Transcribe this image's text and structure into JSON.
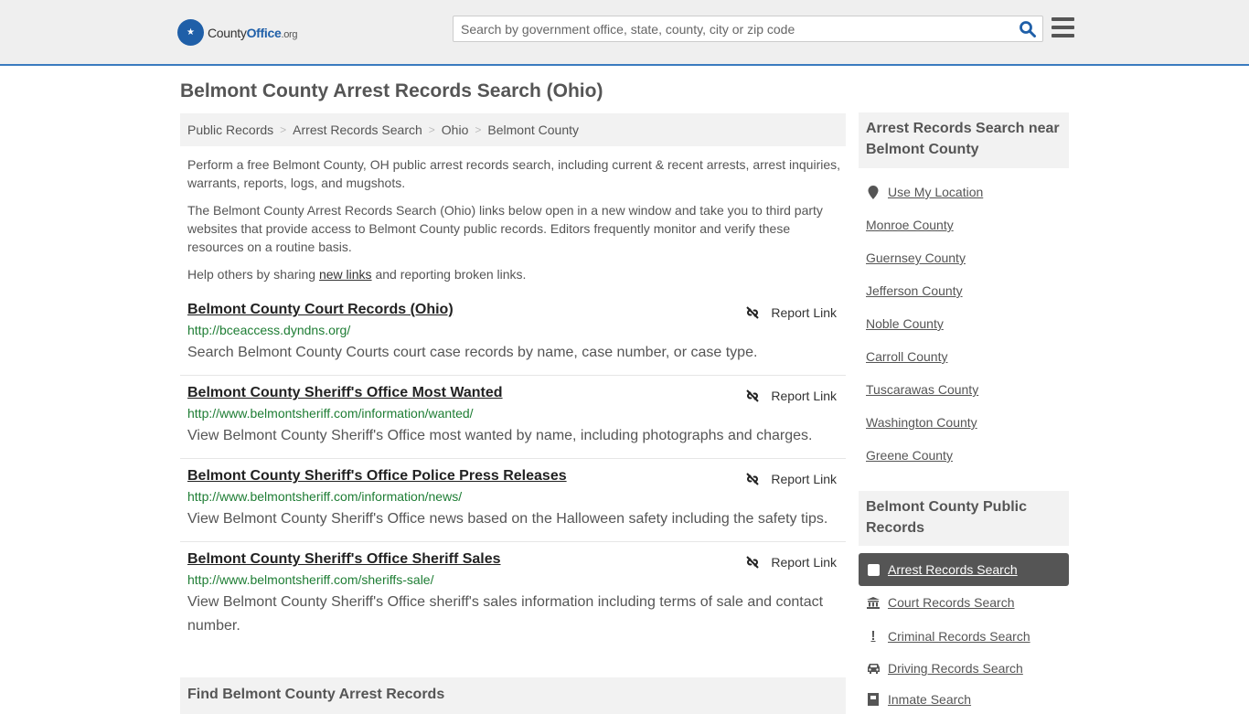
{
  "header": {
    "logo": {
      "part1": "County",
      "part2": "Office",
      "part3": ".org"
    },
    "search_placeholder": "Search by government office, state, county, city or zip code"
  },
  "page_title": "Belmont County Arrest Records Search (Ohio)",
  "breadcrumb": [
    "Public Records",
    "Arrest Records Search",
    "Ohio",
    "Belmont County"
  ],
  "intro": {
    "p1": "Perform a free Belmont County, OH public arrest records search, including current & recent arrests, arrest inquiries, warrants, reports, logs, and mugshots.",
    "p2": "The Belmont County Arrest Records Search (Ohio) links below open in a new window and take you to third party websites that provide access to Belmont County public records. Editors frequently monitor and verify these resources on a routine basis.",
    "p3_before": "Help others by sharing ",
    "p3_link": "new links",
    "p3_after": " and reporting broken links."
  },
  "report_label": "Report Link",
  "results": [
    {
      "title": "Belmont County Court Records (Ohio)",
      "url": "http://bceaccess.dyndns.org/",
      "desc": "Search Belmont County Courts court case records by name, case number, or case type."
    },
    {
      "title": "Belmont County Sheriff's Office Most Wanted",
      "url": "http://www.belmontsheriff.com/information/wanted/",
      "desc": "View Belmont County Sheriff's Office most wanted by name, including photographs and charges."
    },
    {
      "title": "Belmont County Sheriff's Office Police Press Releases",
      "url": "http://www.belmontsheriff.com/information/news/",
      "desc": "View Belmont County Sheriff's Office news based on the Halloween safety including the safety tips."
    },
    {
      "title": "Belmont County Sheriff's Office Sheriff Sales",
      "url": "http://www.belmontsheriff.com/sheriffs-sale/",
      "desc": "View Belmont County Sheriff's Office sheriff's sales information including terms of sale and contact number."
    }
  ],
  "find_heading": "Find Belmont County Arrest Records",
  "sidebar": {
    "nearby_heading": "Arrest Records Search near Belmont County",
    "use_location": "Use My Location",
    "nearby": [
      "Monroe County",
      "Guernsey County",
      "Jefferson County",
      "Noble County",
      "Carroll County",
      "Tuscarawas County",
      "Washington County",
      "Greene County"
    ],
    "public_heading": "Belmont County Public Records",
    "public_items": [
      {
        "label": "Arrest Records Search",
        "icon": "square-icon",
        "active": true
      },
      {
        "label": "Court Records Search",
        "icon": "courthouse-icon"
      },
      {
        "label": "Criminal Records Search",
        "icon": "exclamation-icon"
      },
      {
        "label": "Driving Records Search",
        "icon": "car-icon"
      },
      {
        "label": "Inmate Search",
        "icon": "inmate-icon"
      }
    ]
  }
}
